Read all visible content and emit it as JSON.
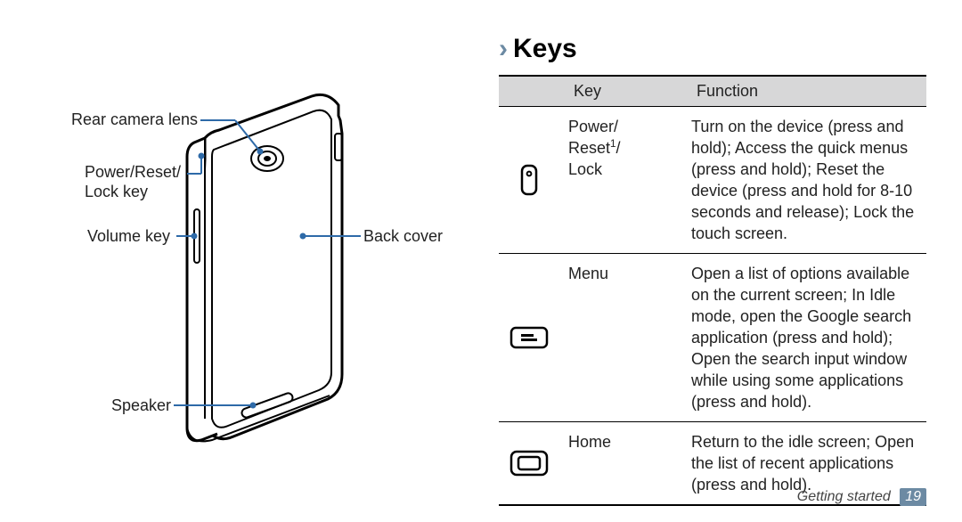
{
  "diagram": {
    "labels": {
      "rear_camera_lens": "Rear camera lens",
      "power_reset_lock_key": "Power/Reset/\nLock key",
      "volume_key": "Volume key",
      "speaker": "Speaker",
      "back_cover": "Back cover"
    }
  },
  "section": {
    "chevron": "›",
    "title": "Keys"
  },
  "table": {
    "header": {
      "key": "Key",
      "function": "Function"
    },
    "rows": [
      {
        "icon": "power-key-icon",
        "name_html": "Power/<br>Reset<sup>1</sup>/<br>Lock",
        "function": "Turn on the device (press and hold); Access the quick menus (press and hold); Reset the device (press and hold for 8-10 seconds and release); Lock the touch screen."
      },
      {
        "icon": "menu-key-icon",
        "name_html": "Menu",
        "function": "Open a list of options available on the current screen; In Idle mode, open the Google search application (press and hold); Open the search input window while using some applications (press and hold)."
      },
      {
        "icon": "home-key-icon",
        "name_html": "Home",
        "function": "Return to the idle screen; Open the list of recent applications (press and hold)."
      }
    ]
  },
  "footer": {
    "section": "Getting started",
    "page": "19"
  }
}
